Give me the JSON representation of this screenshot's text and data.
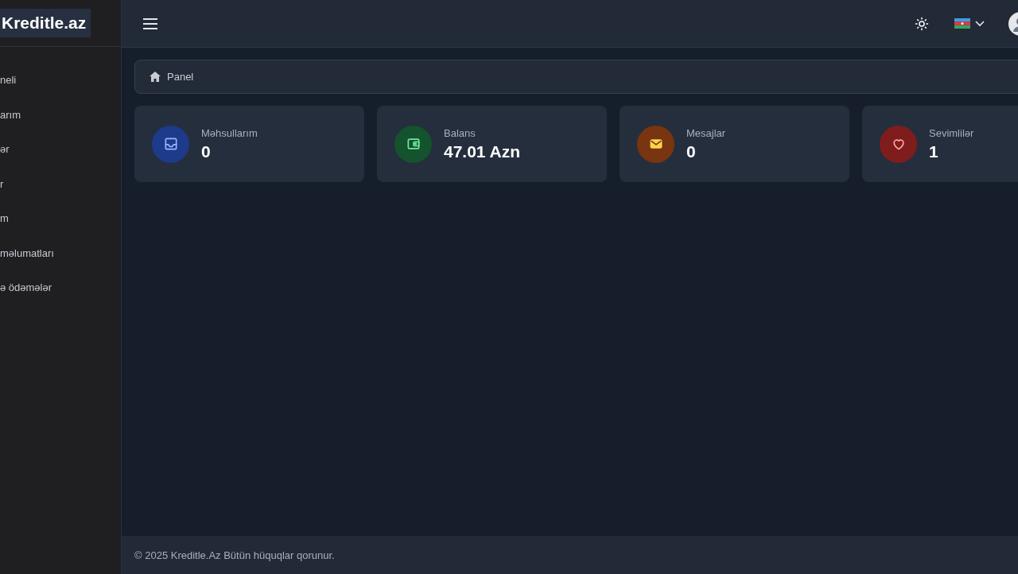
{
  "logo": "Kreditle.az",
  "sidebar": {
    "items": [
      {
        "label": "neli"
      },
      {
        "label": "arım"
      },
      {
        "label": "ər"
      },
      {
        "label": "r"
      },
      {
        "label": "m"
      },
      {
        "label": "məlumatları"
      },
      {
        "label": "ə ödəmələr"
      }
    ]
  },
  "breadcrumb": "Panel",
  "cards": [
    {
      "kind": "inbox",
      "label": "Məhsullarım",
      "value": "0",
      "color": "#1e3a8a"
    },
    {
      "kind": "wallet",
      "label": "Balans",
      "value": "47.01 Azn",
      "color": "#14532d"
    },
    {
      "kind": "mail",
      "label": "Mesajlar",
      "value": "0",
      "color": "#78350f"
    },
    {
      "kind": "heart",
      "label": "Sevimlilər",
      "value": "1",
      "color": "#7f1d1d"
    }
  ],
  "footer": "© 2025 Kreditle.Az Bütün hüquqlar qorunur."
}
